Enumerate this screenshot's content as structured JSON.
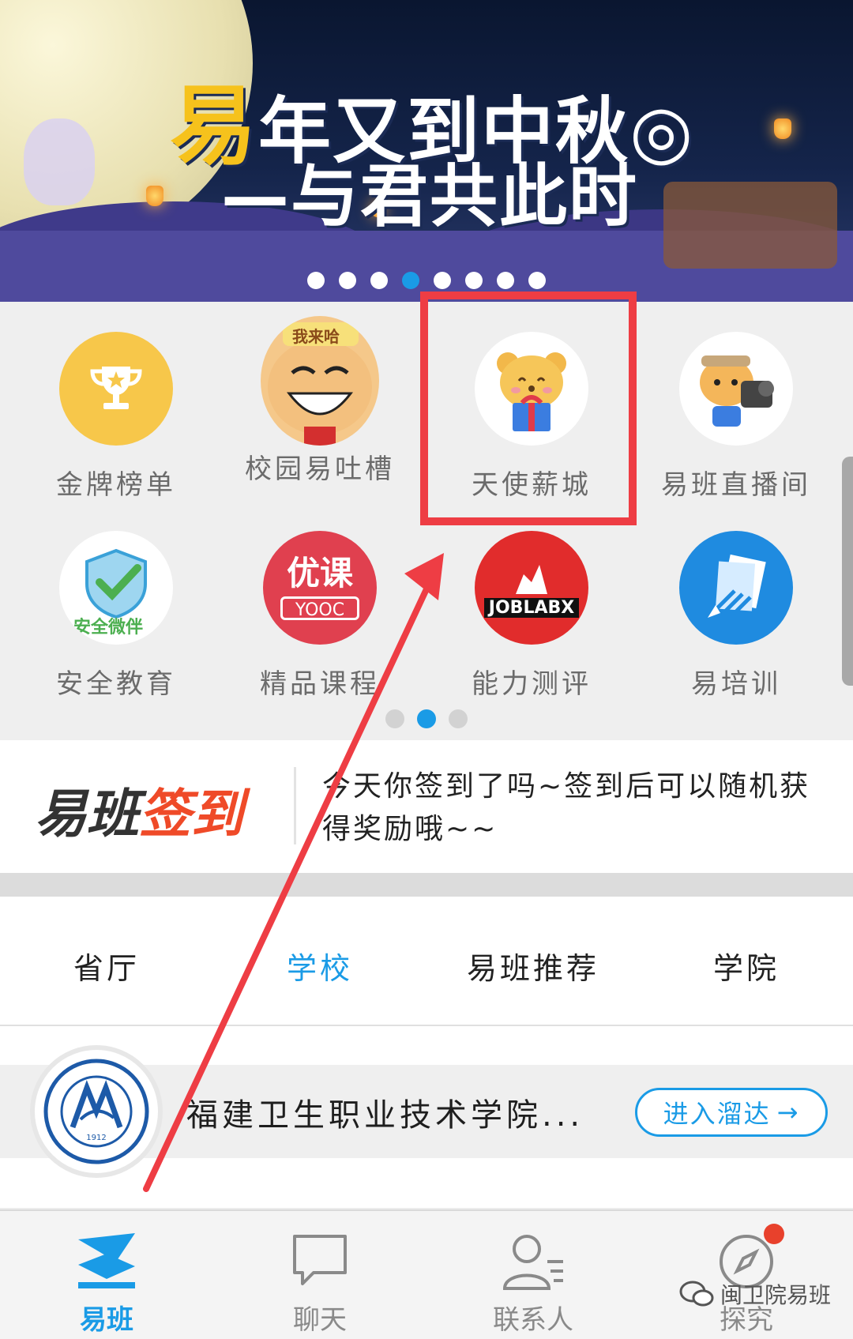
{
  "banner": {
    "title_quote_char": "易",
    "title_line1_rest": "年又到中秋",
    "title_line2": "与君共此时",
    "carousel_dots": 8,
    "active_dot": 3
  },
  "grid": {
    "row1": [
      {
        "label": "金牌榜单",
        "icon": "trophy-icon"
      },
      {
        "label": "校园易吐槽",
        "icon": "laughing-face-icon",
        "badge_text": "我来哈"
      },
      {
        "label": "天使薪城",
        "icon": "gift-bear-icon"
      },
      {
        "label": "易班直播间",
        "icon": "camera-bear-icon"
      }
    ],
    "row2": [
      {
        "label": "安全教育",
        "icon": "shield-check-icon",
        "sub_text": "安全微伴"
      },
      {
        "label": "精品课程",
        "icon": "youke-icon",
        "sub_text_top": "优课",
        "sub_text_bottom": "YOOC"
      },
      {
        "label": "能力测评",
        "icon": "joblabx-icon",
        "sub_text": "JOBLABX"
      },
      {
        "label": "易培训",
        "icon": "training-icon"
      }
    ],
    "page_dots": 3,
    "active_page": 1
  },
  "signin": {
    "logo_part1": "易班",
    "logo_part2": "签到",
    "message": "今天你签到了吗~签到后可以随机获得奖励哦~~"
  },
  "tabs": [
    {
      "label": "省厅",
      "active": false
    },
    {
      "label": "学校",
      "active": true
    },
    {
      "label": "易班推荐",
      "active": false
    },
    {
      "label": "学院",
      "active": false
    }
  ],
  "school": {
    "name": "福建卫生职业技术学院...",
    "badge_year": "1912",
    "enter_label": "进入溜达",
    "enter_arrow": "→"
  },
  "nav": [
    {
      "label": "易班",
      "icon": "yiban-logo-icon",
      "active": true
    },
    {
      "label": "聊天",
      "icon": "chat-bubble-icon",
      "active": false
    },
    {
      "label": "联系人",
      "icon": "contacts-icon",
      "active": false
    },
    {
      "label": "探究",
      "icon": "compass-icon",
      "active": false,
      "has_dot": true
    }
  ],
  "watermark": "闽卫院易班",
  "colors": {
    "accent": "#1a9be6",
    "highlight_box": "#ee3d44",
    "signin_red": "#ef4a28",
    "banner_yellow": "#f6c21c"
  }
}
